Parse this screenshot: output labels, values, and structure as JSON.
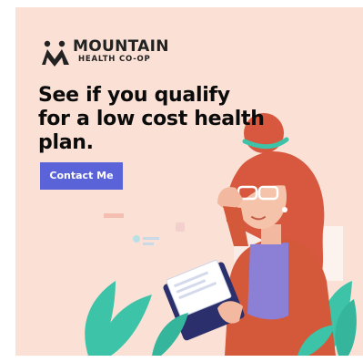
{
  "brand": {
    "name": "MOUNTAIN",
    "tagline": "HEALTH CO-OP",
    "logo_icon": "mountain-people-icon"
  },
  "headline": "See if you qualify for a low cost health plan.",
  "cta": {
    "label": "Contact Me"
  },
  "colors": {
    "background": "#fbe1d5",
    "cta": "#5b63d9",
    "hair": "#d8583f",
    "shirt": "#8b7fd6",
    "jacket": "#d4583a",
    "leaves": "#3cc3a8",
    "clipboard": "#2b2f6b"
  }
}
